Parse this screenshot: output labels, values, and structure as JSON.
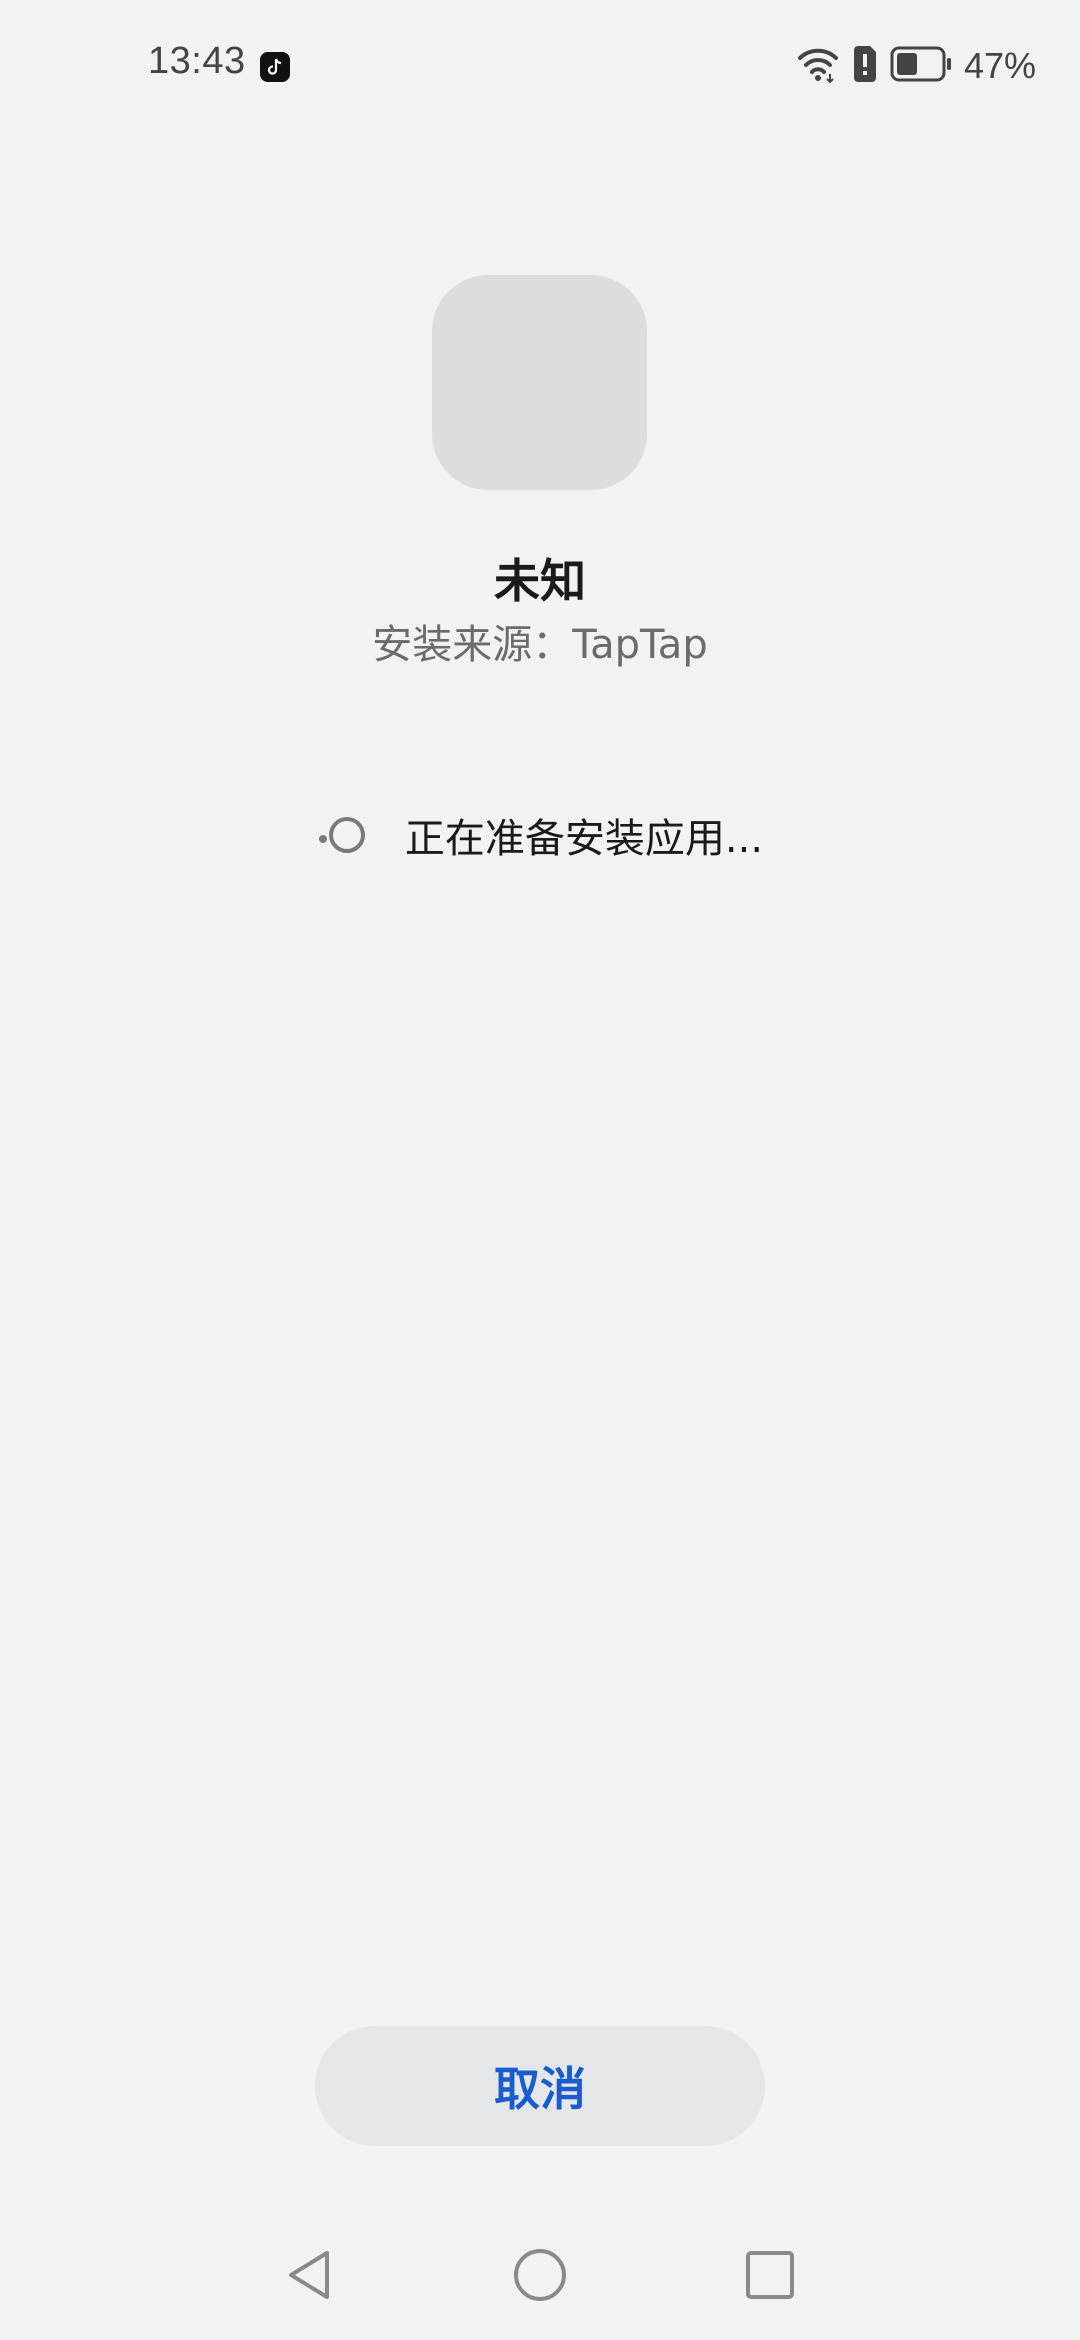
{
  "status_bar": {
    "time": "13:43",
    "battery_percent": "47%",
    "battery_level": 0.47,
    "icons": [
      "tiktok-icon",
      "wifi-icon",
      "sim-alert-icon",
      "battery-icon"
    ]
  },
  "app": {
    "name": "未知",
    "source": "安装来源：TapTap"
  },
  "progress": {
    "text": "正在准备安装应用..."
  },
  "actions": {
    "cancel_label": "取消"
  },
  "colors": {
    "background": "#f1f2f4",
    "accent": "#1a5ccc",
    "icon_placeholder": "#dcdde0",
    "button_bg": "#e5e6e9"
  },
  "nav": {
    "icons": [
      "back-icon",
      "home-icon",
      "recents-icon"
    ]
  }
}
